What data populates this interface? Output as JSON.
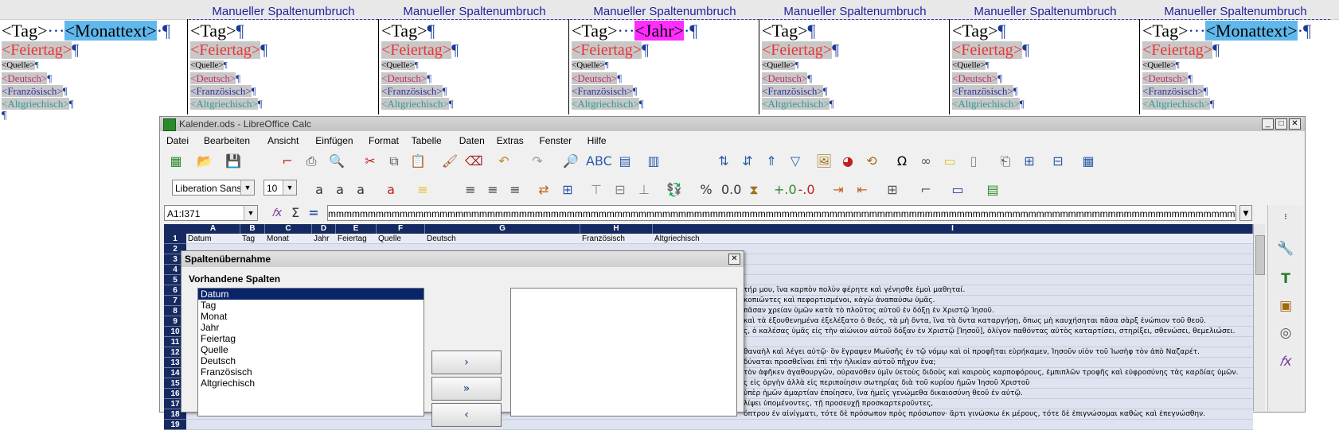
{
  "writer": {
    "page_break_label": "Manueller Spaltenumbruch",
    "pilcrow": "¶",
    "columns": [
      {
        "tag": "<Tag>",
        "extra": "<Monattext>",
        "extra_style": "blue",
        "feiertag": "<Feiertag>",
        "quelle": "<Quelle>",
        "deutsch": "<Deutsch>",
        "franz": "<Französisch>",
        "altgr": "<Altgriechisch>"
      },
      {
        "tag": "<Tag>",
        "extra": "",
        "extra_style": "",
        "feiertag": "<Feiertag>",
        "quelle": "<Quelle>",
        "deutsch": "<Deutsch>",
        "franz": "<Französisch>",
        "altgr": "<Altgriechisch>"
      },
      {
        "tag": "<Tag>",
        "extra": "",
        "extra_style": "",
        "feiertag": "<Feiertag>",
        "quelle": "<Quelle>",
        "deutsch": "<Deutsch>",
        "franz": "<Französisch>",
        "altgr": "<Altgriechisch>"
      },
      {
        "tag": "<Tag>",
        "extra": "<Jahr>",
        "extra_style": "magenta",
        "feiertag": "<Feiertag>",
        "quelle": "<Quelle>",
        "deutsch": "<Deutsch>",
        "franz": "<Französisch>",
        "altgr": "<Altgriechisch>"
      },
      {
        "tag": "<Tag>",
        "extra": "",
        "extra_style": "",
        "feiertag": "<Feiertag>",
        "quelle": "<Quelle>",
        "deutsch": "<Deutsch>",
        "franz": "<Französisch>",
        "altgr": "<Altgriechisch>"
      },
      {
        "tag": "<Tag>",
        "extra": "",
        "extra_style": "",
        "feiertag": "<Feiertag>",
        "quelle": "<Quelle>",
        "deutsch": "<Deutsch>",
        "franz": "<Französisch>",
        "altgr": "<Altgriechisch>"
      },
      {
        "tag": "<Tag>",
        "extra": "<Monattext>",
        "extra_style": "blue",
        "feiertag": "<Feiertag>",
        "quelle": "<Quelle>",
        "deutsch": "<Deutsch>",
        "franz": "<Französisch>",
        "altgr": "<Altgriechisch>"
      }
    ]
  },
  "calc": {
    "window_title": "Kalender.ods - LibreOffice Calc",
    "menu": [
      "Datei",
      "Bearbeiten",
      "Ansicht",
      "Einfügen",
      "Format",
      "Tabelle",
      "Daten",
      "Extras",
      "Fenster",
      "Hilfe"
    ],
    "font_name": "Liberation Sans",
    "font_size": "10",
    "name_box": "A1:I371",
    "formula_content": "mmmmmmmmmmmmmmmmmmmmmmmmmmmmmmmmmmmmmmmmmmmmmmmmmmmmmmmmmmmmmmmmmmmmmmmmmmmmmmmmmmmmmmmmmmmmmmmmmmmmmmmmmmmmmmmmmmmmmmmmmmmmmmmmmmmmmmmmmmmmmmmmmmmmmmmmmmmmmmmmmmmmmmm",
    "col_headers": [
      "A",
      "B",
      "C",
      "D",
      "E",
      "F",
      "G",
      "H",
      "I"
    ],
    "row_headers": [
      "1",
      "2",
      "3",
      "4",
      "5",
      "6",
      "7",
      "8",
      "9",
      "10",
      "11",
      "12",
      "13",
      "14",
      "15",
      "16",
      "17",
      "18",
      "19"
    ],
    "header_row": [
      "Datum",
      "Tag",
      "Monat",
      "Jahr",
      "Feiertag",
      "Quelle",
      "Deutsch",
      "Französisch",
      "Altgriechisch"
    ],
    "greek_rows": [
      "",
      "",
      "",
      "",
      "τήρ μου, ἵνα καρπὸν πολὺν φέρητε καὶ γένησθε ἐμοὶ μαθηταί.",
      "κοπιῶντες καὶ πεφορτισμένοι, κἀγὼ ἀναπαύσω ὑμᾶς.",
      "πᾶσαν χρείαν ὑμῶν κατὰ τὸ πλοῦτος αὐτοῦ ἐν δόξῃ ἐν Χριστῷ Ἰησοῦ.",
      "καὶ τὰ ἐξουθενημένα ἐξελέξατο ὁ θεός, τὰ μὴ ὄντα, ἵνα τὰ ὄντα καταργήσῃ, ὅπως μὴ καυχήσηται πᾶσα σὰρξ ἐνώπιον τοῦ θεοῦ.",
      "ς, ὁ καλέσας ὑμᾶς εἰς τὴν αἰώνιον αὐτοῦ δόξαν ἐν Χριστῷ [Ἰησοῦ], ὀλίγον παθόντας αὐτὸς καταρτίσει, στηρίξει, σθενώσει, θεμελιώσει.",
      "",
      "θαναὴλ καὶ λέγει αὐτῷ· ὃν ἔγραψεν Μωϋσῆς ἐν τῷ νόμῳ καὶ οἱ προφῆται εὑρήκαμεν, Ἰησοῦν υἱὸν τοῦ Ἰωσὴφ τὸν ἀπὸ Ναζαρέτ.",
      "δύναται προσθεῖναι ἐπὶ τὴν ἡλικίαν αὐτοῦ πῆχυν ἕνα;",
      "τὸν ἀφῆκεν ἀγαθουργῶν, οὐρανόθεν ὑμῖν ὑετοὺς διδοὺς καὶ καιροὺς καρποφόρους, ἐμπιπλῶν τροφῆς καὶ εὐφροσύνης τὰς καρδίας ὑμῶν.",
      "ς εἰς ὀργὴν ἀλλὰ εἰς περιποίησιν σωτηρίας διὰ τοῦ κυρίου ἡμῶν Ἰησοῦ Χριστοῦ",
      "ὑπὲρ ἡμῶν ἁμαρτίαν ἐποίησεν, ἵνα ἡμεῖς γενώμεθα δικαιοσύνη θεοῦ ἐν αὐτῷ.",
      "λίψει ὑπομένοντες, τῇ προσευχῇ προσκαρτεροῦντες,",
      "όπτρου ἐν αἰνίγματι, τότε δὲ πρόσωπον πρὸς πρόσωπον· ἄρτι γινώσκω ἐκ μέρους, τότε δὲ ἐπιγνώσομαι καθὼς καὶ ἐπεγνώσθην."
    ]
  },
  "dialog": {
    "title": "Spaltenübernahme",
    "label": "Vorhandene Spalten",
    "items": [
      "Datum",
      "Tag",
      "Monat",
      "Jahr",
      "Feiertag",
      "Quelle",
      "Deutsch",
      "Französisch",
      "Altgriechisch"
    ],
    "selected": "Datum",
    "btn_add": "›",
    "btn_add_all": "»",
    "btn_remove": "‹"
  }
}
